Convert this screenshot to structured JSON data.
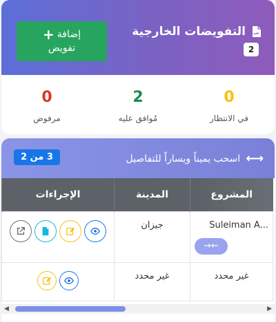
{
  "header": {
    "title": "التفويضات الخارجية",
    "count": "2",
    "add_label_line1": "إضافة",
    "add_label_line2": "تفويض"
  },
  "stats": [
    {
      "value": "0",
      "label": "في الانتظار",
      "color": "#f5c211"
    },
    {
      "value": "2",
      "label": "مُوافق عليه",
      "color": "#1e8a52"
    },
    {
      "value": "0",
      "label": "مرفوض",
      "color": "#d9382c"
    }
  ],
  "table_section": {
    "hint": "اسحب يميناً ويساراً للتفاصيل",
    "page_badge": "3 من 2",
    "columns": [
      "المشروع",
      "المدينة",
      "الإجراءات"
    ],
    "rows": [
      {
        "project": "Suleiman A...",
        "city": "جيزان",
        "actions": [
          "view",
          "edit",
          "document",
          "open-external"
        ]
      },
      {
        "project": "غير محدد",
        "city": "غير محدد",
        "actions": [
          "view",
          "edit"
        ]
      }
    ],
    "swipe_glyph": "←→"
  },
  "icons": {
    "title_icon": "file-signature-icon",
    "drag_icon": "arrows-horizontal-icon"
  },
  "colors": {
    "hero_gradient_start": "#5c6fd8",
    "hero_gradient_end": "#8e5bbb",
    "add_button": "#27a55e",
    "page_badge": "#1976e8"
  }
}
